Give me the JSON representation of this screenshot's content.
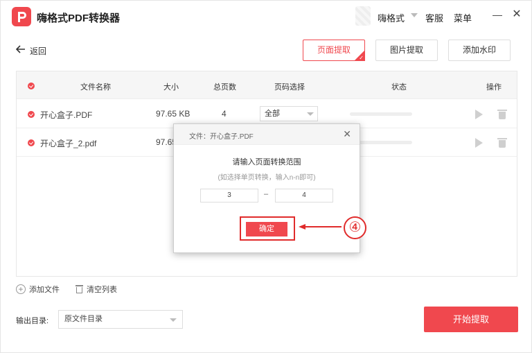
{
  "app": {
    "title": "嗨格式PDF转换器",
    "user_name": "嗨格式",
    "menu_service": "客服",
    "menu_main": "菜单",
    "minimize_glyph": "—",
    "close_glyph": "✕"
  },
  "toolbar": {
    "back_label": "返回",
    "tabs": [
      {
        "label": "页面提取",
        "active": true
      },
      {
        "label": "图片提取",
        "active": false
      },
      {
        "label": "添加水印",
        "active": false
      }
    ]
  },
  "table": {
    "headers": {
      "name": "文件名称",
      "size": "大小",
      "pages": "总页数",
      "page_select": "页码选择",
      "status": "状态",
      "actions": "操作"
    },
    "rows": [
      {
        "name": "开心盒子.PDF",
        "size": "97.65 KB",
        "pages": "4",
        "page_select": "全部",
        "progress": 0
      },
      {
        "name": "开心盒子_2.pdf",
        "size": "97.65",
        "pages": "",
        "page_select": "",
        "progress": 0
      }
    ]
  },
  "bottom": {
    "add_file": "添加文件",
    "clear_list": "清空列表",
    "output_label": "输出目录:",
    "output_value": "原文件目录",
    "start_button": "开始提取"
  },
  "modal": {
    "file_label": "文件：开心盒子.PDF",
    "title": "请输入页面转换范围",
    "hint": "(如选择单页转换，输入n-n即可)",
    "range_from": "3",
    "range_dash": "–",
    "range_to": "4",
    "confirm": "确定"
  },
  "annotation": {
    "step": "④"
  },
  "colors": {
    "accent": "#f0484e",
    "annotation": "#e02b2b"
  }
}
